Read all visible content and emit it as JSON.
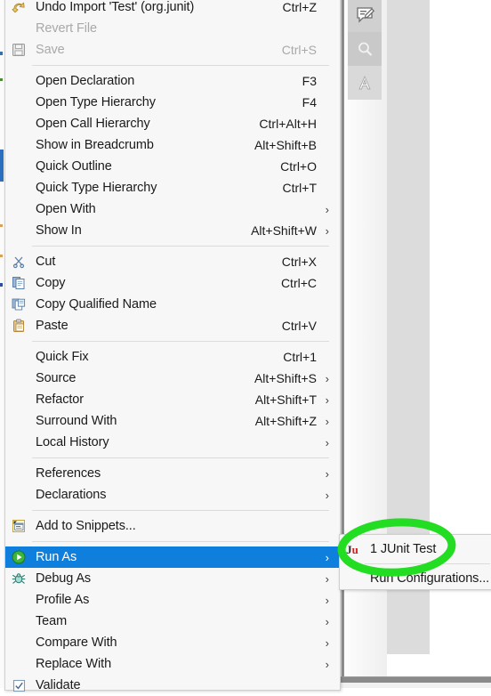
{
  "app": {
    "kind": "eclipse-context-menu",
    "highlight_color": "#0f7fdd",
    "menu_bg": "#f7f7f7",
    "annotation_color": "#22dd22"
  },
  "toolbar": {
    "items": [
      {
        "name": "annotate-tool",
        "icon": "pencil-note-icon"
      },
      {
        "name": "search-tool",
        "icon": "search-icon"
      },
      {
        "name": "text-tool",
        "icon": "text-a-icon"
      }
    ]
  },
  "context_menu": {
    "groups": [
      {
        "items": [
          {
            "icon": "undo-arrow-icon",
            "label": "Undo Import 'Test' (org.junit)",
            "accel": "Ctrl+Z",
            "submenu": false,
            "disabled": false
          },
          {
            "icon": "",
            "label": "Revert File",
            "accel": "",
            "submenu": false,
            "disabled": true
          },
          {
            "icon": "save-disk-icon",
            "label": "Save",
            "accel": "Ctrl+S",
            "submenu": false,
            "disabled": true
          }
        ]
      },
      {
        "items": [
          {
            "icon": "",
            "label": "Open Declaration",
            "accel": "F3",
            "submenu": false,
            "disabled": false
          },
          {
            "icon": "",
            "label": "Open Type Hierarchy",
            "accel": "F4",
            "submenu": false,
            "disabled": false
          },
          {
            "icon": "",
            "label": "Open Call Hierarchy",
            "accel": "Ctrl+Alt+H",
            "submenu": false,
            "disabled": false
          },
          {
            "icon": "",
            "label": "Show in Breadcrumb",
            "accel": "Alt+Shift+B",
            "submenu": false,
            "disabled": false
          },
          {
            "icon": "",
            "label": "Quick Outline",
            "accel": "Ctrl+O",
            "submenu": false,
            "disabled": false
          },
          {
            "icon": "",
            "label": "Quick Type Hierarchy",
            "accel": "Ctrl+T",
            "submenu": false,
            "disabled": false
          },
          {
            "icon": "",
            "label": "Open With",
            "accel": "",
            "submenu": true,
            "disabled": false
          },
          {
            "icon": "",
            "label": "Show In",
            "accel": "Alt+Shift+W",
            "submenu": true,
            "disabled": false
          }
        ]
      },
      {
        "items": [
          {
            "icon": "scissors-icon",
            "label": "Cut",
            "accel": "Ctrl+X",
            "submenu": false,
            "disabled": false
          },
          {
            "icon": "copy-icon",
            "label": "Copy",
            "accel": "Ctrl+C",
            "submenu": false,
            "disabled": false
          },
          {
            "icon": "copy-qualified-icon",
            "label": "Copy Qualified Name",
            "accel": "",
            "submenu": false,
            "disabled": false
          },
          {
            "icon": "clipboard-paste-icon",
            "label": "Paste",
            "accel": "Ctrl+V",
            "submenu": false,
            "disabled": false
          }
        ]
      },
      {
        "items": [
          {
            "icon": "",
            "label": "Quick Fix",
            "accel": "Ctrl+1",
            "submenu": false,
            "disabled": false
          },
          {
            "icon": "",
            "label": "Source",
            "accel": "Alt+Shift+S",
            "submenu": true,
            "disabled": false
          },
          {
            "icon": "",
            "label": "Refactor",
            "accel": "Alt+Shift+T",
            "submenu": true,
            "disabled": false
          },
          {
            "icon": "",
            "label": "Surround With",
            "accel": "Alt+Shift+Z",
            "submenu": true,
            "disabled": false
          },
          {
            "icon": "",
            "label": "Local History",
            "accel": "",
            "submenu": true,
            "disabled": false
          }
        ]
      },
      {
        "items": [
          {
            "icon": "",
            "label": "References",
            "accel": "",
            "submenu": true,
            "disabled": false
          },
          {
            "icon": "",
            "label": "Declarations",
            "accel": "",
            "submenu": true,
            "disabled": false
          }
        ]
      },
      {
        "items": [
          {
            "icon": "snippets-icon",
            "label": "Add to Snippets...",
            "accel": "",
            "submenu": false,
            "disabled": false
          }
        ]
      },
      {
        "items": [
          {
            "icon": "run-play-icon",
            "label": "Run As",
            "accel": "",
            "submenu": true,
            "disabled": false,
            "selected": true
          },
          {
            "icon": "debug-bug-icon",
            "label": "Debug As",
            "accel": "",
            "submenu": true,
            "disabled": false
          },
          {
            "icon": "",
            "label": "Profile As",
            "accel": "",
            "submenu": true,
            "disabled": false
          },
          {
            "icon": "",
            "label": "Team",
            "accel": "",
            "submenu": true,
            "disabled": false
          },
          {
            "icon": "",
            "label": "Compare With",
            "accel": "",
            "submenu": true,
            "disabled": false
          },
          {
            "icon": "",
            "label": "Replace With",
            "accel": "",
            "submenu": true,
            "disabled": false
          },
          {
            "icon": "checkbox-checked-icon",
            "label": "Validate",
            "accel": "",
            "submenu": false,
            "disabled": false
          }
        ]
      }
    ]
  },
  "submenu": {
    "title": "Run As",
    "items": [
      {
        "icon": "junit-icon",
        "label": "1 JUnit Test",
        "submenu": false
      },
      {
        "icon": "",
        "label": "Run Configurations...",
        "submenu": false
      }
    ]
  }
}
